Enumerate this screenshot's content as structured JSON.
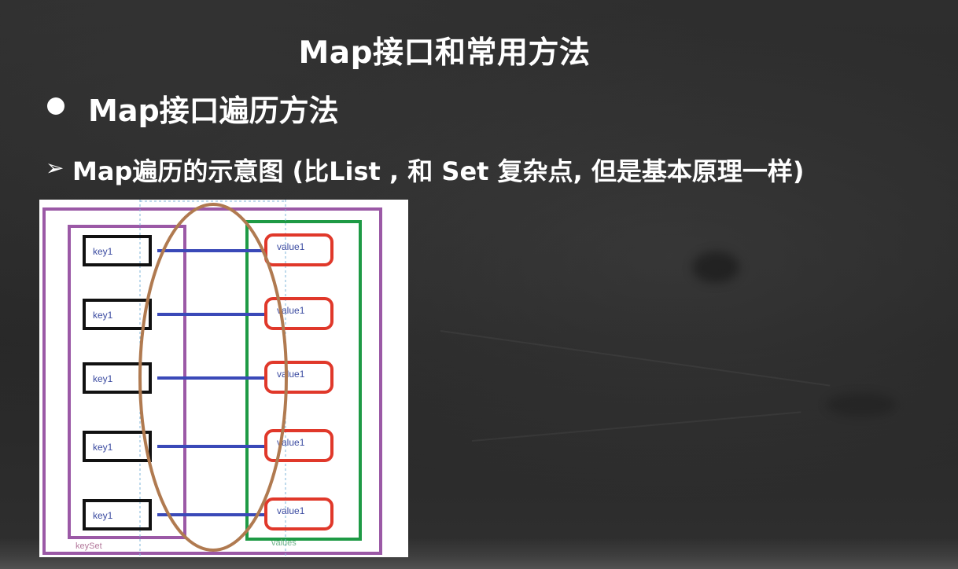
{
  "slide": {
    "title": "Map接口和常用方法",
    "bullet": "Map接口遍历方法",
    "sub_arrow": "➢",
    "subheading": "Map遍历的示意图 (比List , 和 Set 复杂点, 但是基本原理一样)"
  },
  "diagram": {
    "keys": [
      "key1",
      "key1",
      "key1",
      "key1",
      "key1"
    ],
    "values": [
      "value1",
      "value1",
      "value1",
      "value1",
      "value1"
    ],
    "keyset_label": "keySet",
    "values_label": "values",
    "colors": {
      "outer_box": "#9b59a6",
      "keyset_box": "#9b59a6",
      "values_box": "#1e9a45",
      "key_box": "#111111",
      "value_box": "#e0382a",
      "connector": "#3a49b8",
      "entry_ellipse": "#b07a50",
      "key_text": "#3a4aa0"
    }
  }
}
